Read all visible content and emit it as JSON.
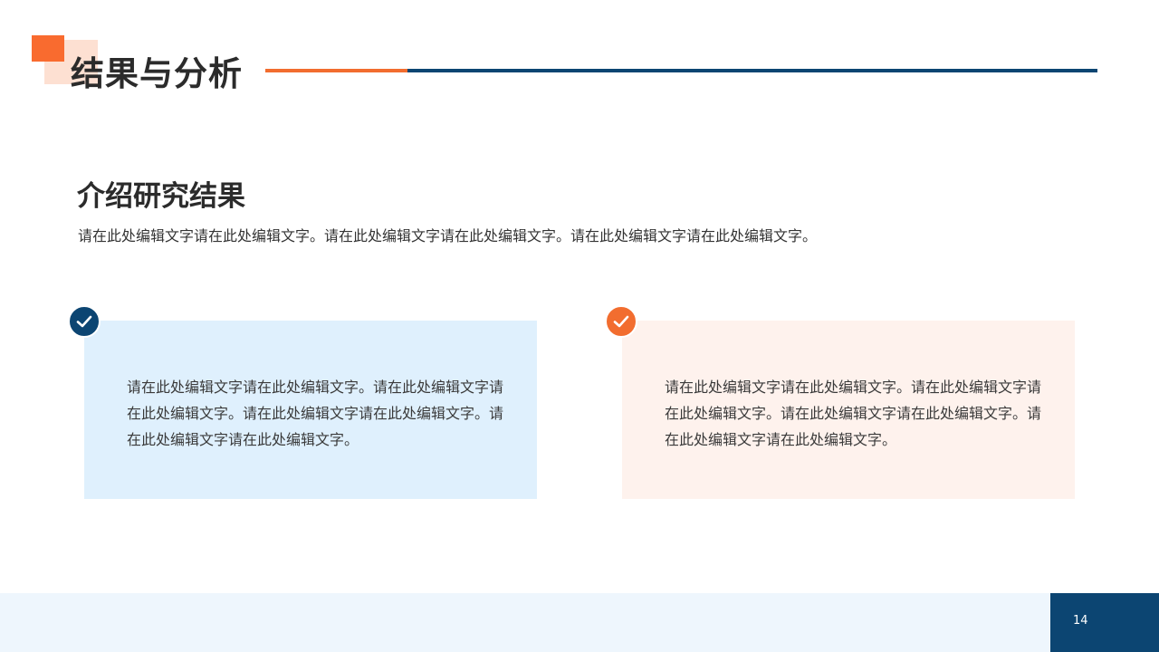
{
  "slide": {
    "title": "结果与分析",
    "page_number": "14"
  },
  "section": {
    "heading": "介绍研究结果",
    "intro": "请在此处编辑文字请在此处编辑文字。请在此处编辑文字请在此处编辑文字。请在此处编辑文字请在此处编辑文字。"
  },
  "cards": [
    {
      "icon": "check-icon",
      "accent": "#0c4572",
      "background": "#dff0fd",
      "text": "请在此处编辑文字请在此处编辑文字。请在此处编辑文字请在此处编辑文字。请在此处编辑文字请在此处编辑文字。请在此处编辑文字请在此处编辑文字。"
    },
    {
      "icon": "check-icon",
      "accent": "#f26d2f",
      "background": "#fef2ed",
      "text": "请在此处编辑文字请在此处编辑文字。请在此处编辑文字请在此处编辑文字。请在此处编辑文字请在此处编辑文字。请在此处编辑文字请在此处编辑文字。"
    }
  ],
  "colors": {
    "orange": "#f26d2f",
    "navy": "#0c4572",
    "peach": "#fde0d2",
    "footer": "#eef6fd"
  }
}
